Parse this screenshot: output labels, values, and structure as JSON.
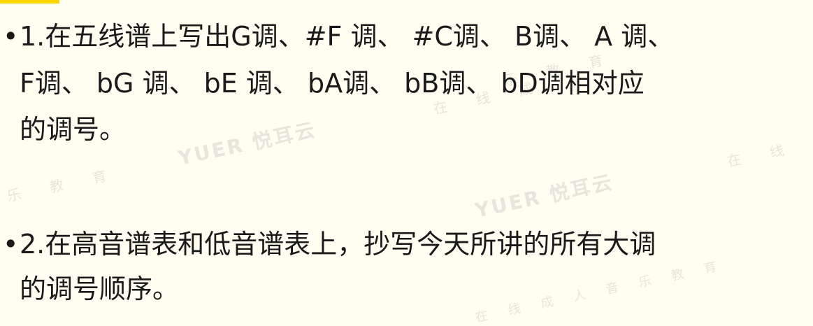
{
  "watermark": {
    "brand": "YUER 悦耳云",
    "tagline_a": "在 线 成",
    "tagline_b": "乐 教 育",
    "tagline_c": "在 线 成 人 音 乐 教 育"
  },
  "items": [
    {
      "bullet": "•",
      "lines": [
        "1.在五线谱上写出G调、#F 调、 #C调、  B调、  A 调、",
        "F调、 bG 调、  bE 调、 bA调、  bB调、 bD调相对应",
        "的调号。"
      ]
    },
    {
      "bullet": "•",
      "lines": [
        " 2.在高音谱表和低音谱表上，抄写今天所讲的所有大调",
        "的调号顺序。"
      ]
    }
  ],
  "colors": {
    "accent": "#ffd400",
    "background": "#fffef0",
    "text": "#1a1a1a"
  }
}
